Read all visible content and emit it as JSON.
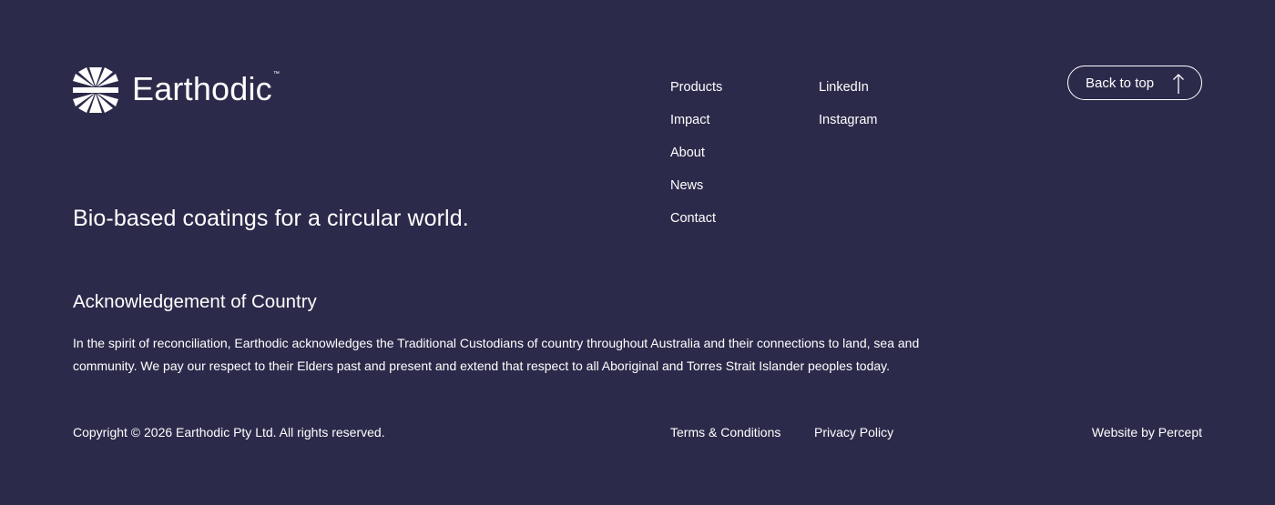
{
  "brand": {
    "name": "Earthodic",
    "trademark": "™",
    "logo_icon": "sunburst-logo-icon"
  },
  "tagline": "Bio-based coatings for a circular world.",
  "nav": {
    "primary": [
      {
        "label": "Products"
      },
      {
        "label": "Impact"
      },
      {
        "label": "About"
      },
      {
        "label": "News"
      },
      {
        "label": "Contact"
      }
    ],
    "social": [
      {
        "label": "LinkedIn"
      },
      {
        "label": "Instagram"
      }
    ]
  },
  "back_to_top": {
    "label": "Back to top",
    "icon": "arrow-up-icon"
  },
  "acknowledgement": {
    "title": "Acknowledgement of Country",
    "body": "In the spirit of reconciliation, Earthodic acknowledges the Traditional Custodians of country throughout Australia and their connections to land, sea and community. We pay our respect to their Elders past and present and extend that respect to all Aboriginal and Torres Strait Islander peoples today."
  },
  "footer": {
    "copyright": "Copyright © 2026 Earthodic Pty Ltd. All rights reserved.",
    "terms": "Terms & Conditions",
    "privacy": "Privacy Policy",
    "credit": "Website by Percept"
  },
  "colors": {
    "background": "#2c2a4a",
    "text": "#ffffff"
  }
}
